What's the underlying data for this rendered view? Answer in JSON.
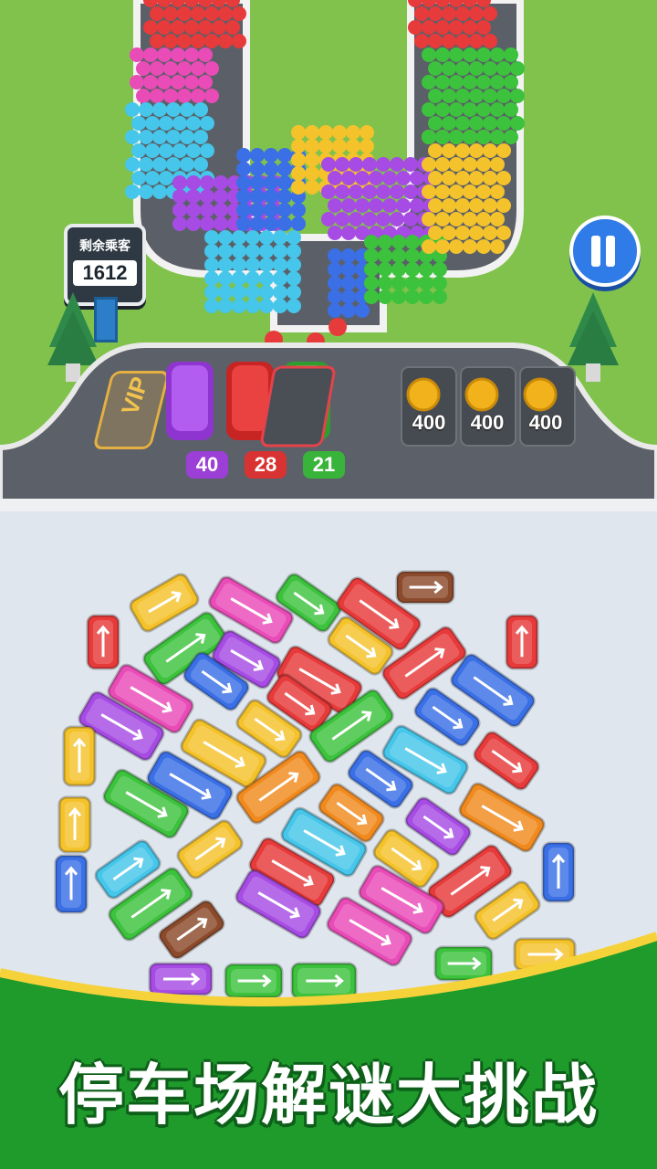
{
  "sign": {
    "title": "剩余乘客",
    "passengers": "1612"
  },
  "parking": {
    "vip_label": "VIP",
    "slots": [
      {
        "color": "#a24be0",
        "count": "40",
        "badge": "#9b3fd6"
      },
      {
        "color": "#e23b3b",
        "count": "28",
        "badge": "#d93232"
      },
      {
        "color": "#3fbf3f",
        "count": "21",
        "badge": "#39b43a"
      }
    ],
    "locked_slots": [
      {
        "price": "400",
        "icon": "coin-icon"
      },
      {
        "price": "400",
        "icon": "coin-icon"
      },
      {
        "price": "400",
        "icon": "coin-icon"
      }
    ]
  },
  "controls": {
    "pause_icon": "pause-icon"
  },
  "banner": {
    "title": "停车场解谜大挑战",
    "color": "#1f9b2c"
  },
  "colors": {
    "red": "#e73a3a",
    "green": "#3cc23c",
    "blue": "#3a6fe6",
    "yellow": "#f4c22b",
    "purple": "#a64be3",
    "pink": "#e94bb7",
    "cyan": "#45c6ea",
    "orange": "#f08a1e",
    "brown": "#8b4a2b"
  }
}
